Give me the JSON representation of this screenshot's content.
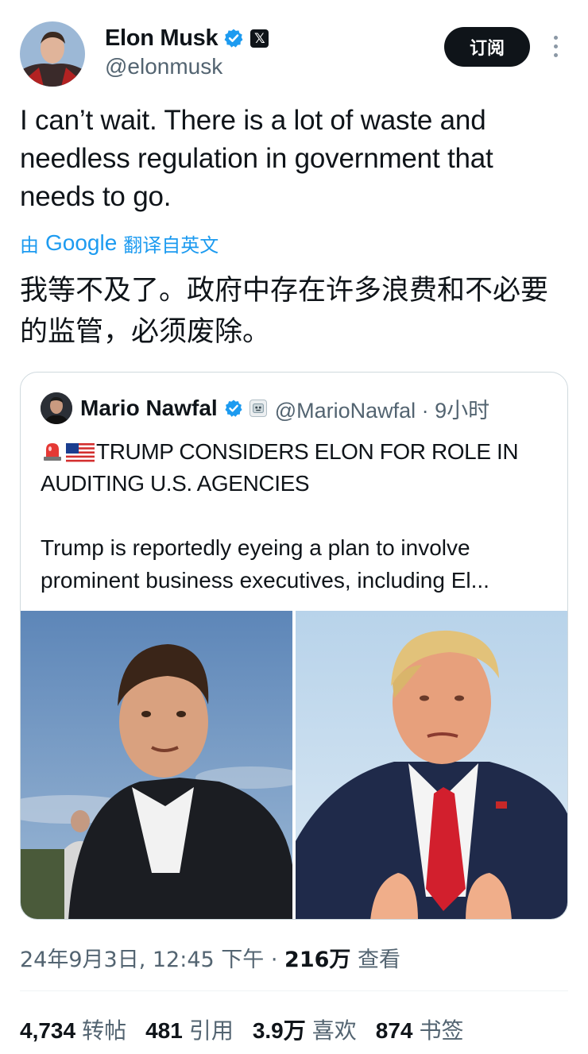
{
  "author": {
    "name": "Elon Musk",
    "handle": "@elonmusk",
    "badge_glyph": "𝕏"
  },
  "subscribe_label": "订阅",
  "tweet": {
    "text": "I can’t wait. There is a lot of waste and needless regulation in government that needs to go.",
    "translate_prefix": "由",
    "translate_brand": "Google",
    "translate_suffix": "翻译自英文",
    "translated_text": "我等不及了。政府中存在许多浪费和不必要的监管，必须废除。"
  },
  "quote": {
    "name": "Mario Nawfal",
    "handle": "@MarioNawfal · 9小时",
    "title": "TRUMP CONSIDERS ELON FOR ROLE IN AUDITING U.S. AGENCIES",
    "description": "Trump is reportedly eyeing a plan to involve prominent business executives, including El..."
  },
  "meta": {
    "timestamp": "24年9月3日, 12:45 下午 · ",
    "views_count": "216万",
    "views_label": " 查看"
  },
  "stats": [
    {
      "count": "4,734",
      "label": "转帖"
    },
    {
      "count": "481",
      "label": "引用"
    },
    {
      "count": "3.9万",
      "label": "喜欢"
    },
    {
      "count": "874",
      "label": "书签"
    }
  ],
  "colors": {
    "accent": "#1d9bf0",
    "text": "#0f1419",
    "muted": "#536471",
    "border": "#cfd9de"
  },
  "icons": [
    "verified-icon",
    "x-logo-icon",
    "more-icon",
    "siren-icon",
    "us-flag-icon",
    "robot-emoji-icon"
  ]
}
